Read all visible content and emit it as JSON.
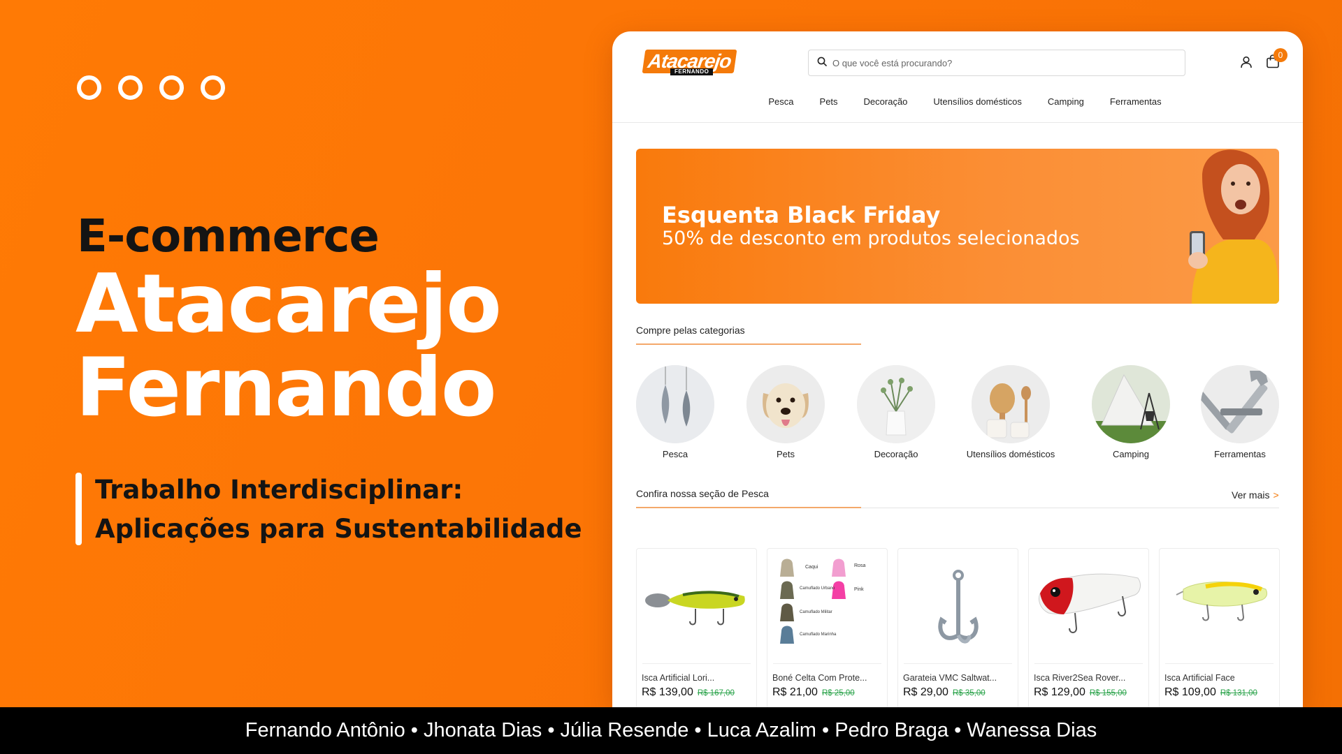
{
  "slide": {
    "heading_small": "E-commerce",
    "brand_line_1": "Atacarejo",
    "brand_line_2": "Fernando",
    "subtitle_line_1": "Trabalho Interdisciplinar:",
    "subtitle_line_2": "Aplicações para Sustentabilidade",
    "authors": "Fernando Antônio • Jhonata Dias • Júlia Resende • Luca Azalim • Pedro Braga • Wanessa Dias",
    "accent_color": "#f97a0a"
  },
  "site": {
    "logo": {
      "name": "Atacarejo",
      "tagline": "FERNANDO"
    },
    "search": {
      "placeholder": "O que você está procurando?",
      "icon": "search-icon"
    },
    "header_icons": {
      "user": "user-icon",
      "cart": "shopping-bag-icon",
      "cart_count": "0"
    },
    "nav": [
      "Pesca",
      "Pets",
      "Decoração",
      "Utensílios domésticos",
      "Camping",
      "Ferramentas"
    ],
    "banner": {
      "title": "Esquenta Black Friday",
      "subtitle": "50% de desconto em produtos selecionados"
    },
    "categories_section": {
      "title": "Compre pelas categorias",
      "items": [
        "Pesca",
        "Pets",
        "Decoração",
        "Utensílios domésticos",
        "Camping",
        "Ferramentas"
      ]
    },
    "products_section": {
      "title": "Confira nossa seção de Pesca",
      "see_more": "Ver mais",
      "see_more_arrow": ">",
      "products": [
        {
          "name": "Isca Artificial Lori...",
          "price": "R$ 139,00",
          "old_price": "R$ 167,00"
        },
        {
          "name": "Boné Celta Com Prote...",
          "price": "R$ 21,00",
          "old_price": "R$ 25,00",
          "variant_labels": [
            "Caqui",
            "Rosa",
            "Camuflado Urbano",
            "Pink",
            "Camuflado Militar",
            "Camuflado Marinha"
          ]
        },
        {
          "name": "Garateia VMC Saltwat...",
          "price": "R$ 29,00",
          "old_price": "R$ 35,00"
        },
        {
          "name": "Isca River2Sea Rover...",
          "price": "R$ 129,00",
          "old_price": "R$ 155,00"
        },
        {
          "name": "Isca Artificial Face",
          "price": "R$ 109,00",
          "old_price": "R$ 131,00"
        }
      ]
    }
  }
}
